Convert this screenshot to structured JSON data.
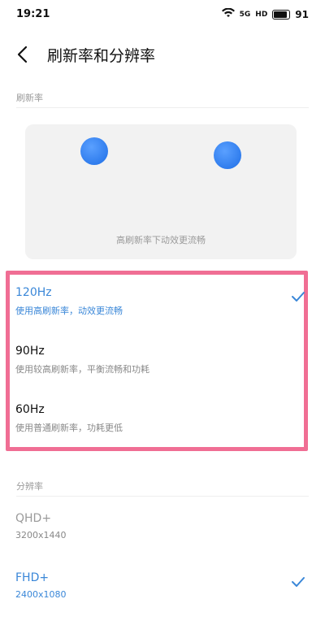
{
  "status_bar": {
    "time": "19:21",
    "signal_text": "5G",
    "hd_text": "HD",
    "battery_level": "91"
  },
  "header": {
    "title": "刷新率和分辨率"
  },
  "refresh_section": {
    "label": "刷新率",
    "preview_caption": "高刷新率下动效更流畅",
    "options": [
      {
        "title": "120Hz",
        "subtitle": "使用高刷新率，动效更流畅",
        "selected": true
      },
      {
        "title": "90Hz",
        "subtitle": "使用较高刷新率，平衡流畅和功耗",
        "selected": false
      },
      {
        "title": "60Hz",
        "subtitle": "使用普通刷新率，功耗更低",
        "selected": false
      }
    ]
  },
  "resolution_section": {
    "label": "分辨率",
    "options": [
      {
        "title": "QHD+",
        "subtitle": "3200x1440",
        "selected": false,
        "disabled": true
      },
      {
        "title": "FHD+",
        "subtitle": "2400x1080",
        "selected": true,
        "disabled": false
      }
    ]
  },
  "colors": {
    "accent": "#3a87d8",
    "highlight": "#f06e94",
    "dot": "#1e6ee6"
  }
}
